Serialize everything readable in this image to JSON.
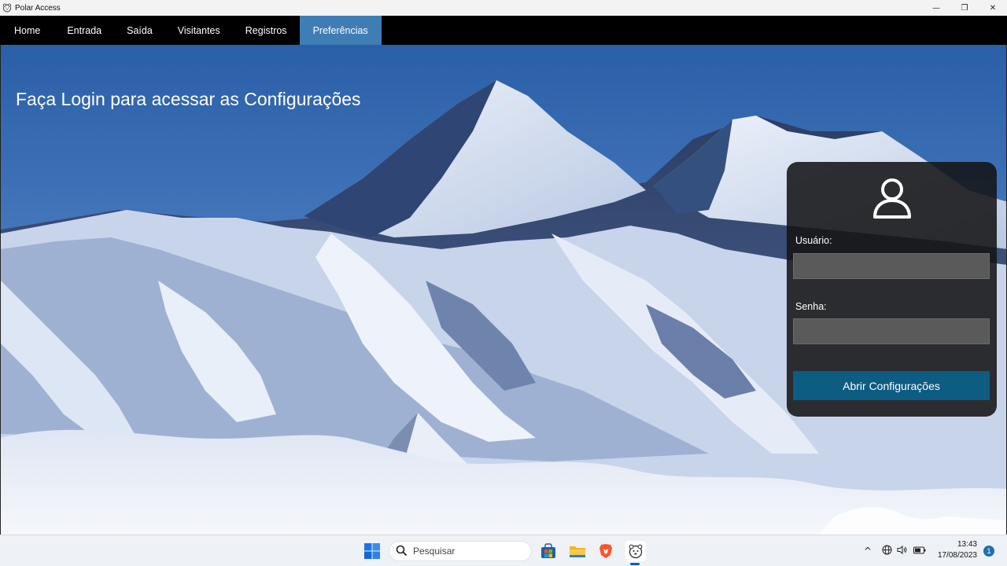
{
  "window": {
    "title": "Polar Access",
    "controls": {
      "minimize": "—",
      "maximize": "❐",
      "close": "✕"
    }
  },
  "nav": {
    "items": [
      {
        "label": "Home"
      },
      {
        "label": "Entrada"
      },
      {
        "label": "Saída"
      },
      {
        "label": "Visitantes"
      },
      {
        "label": "Registros"
      },
      {
        "label": "Preferências",
        "active": true
      }
    ]
  },
  "main": {
    "heading": "Faça Login para acessar as Configurações",
    "login": {
      "icon": "user-icon",
      "user_label": "Usuário:",
      "user_value": "",
      "password_label": "Senha:",
      "password_value": "",
      "submit_label": "Abrir Configurações"
    }
  },
  "taskbar": {
    "search_placeholder": "Pesquisar",
    "time": "13:43",
    "date": "17/08/2023",
    "notifications": "1",
    "tray_chevron": "^"
  },
  "colors": {
    "nav_active": "#3f7db5",
    "submit": "#0d5c82",
    "panel": "#141416"
  }
}
